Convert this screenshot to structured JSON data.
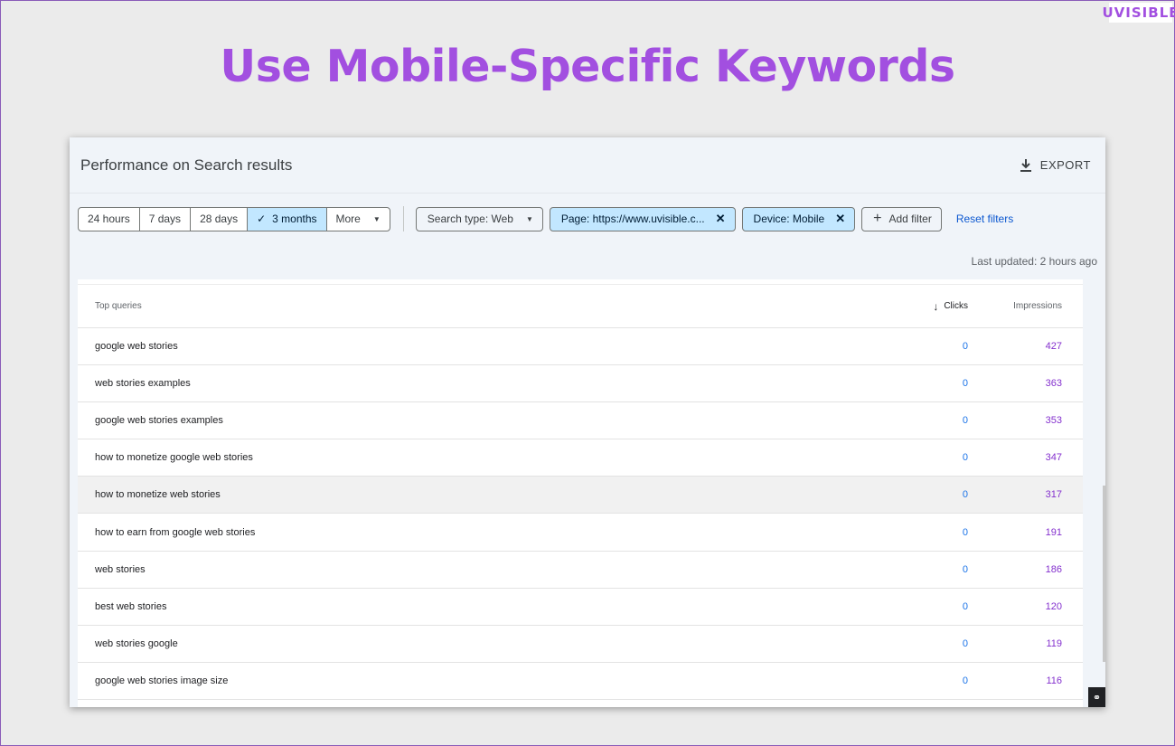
{
  "brand": {
    "logo_text": "UVISIBLE"
  },
  "headline": "Use Mobile-Specific Keywords",
  "panel": {
    "title": "Performance on Search results",
    "export_label": "EXPORT",
    "export_icon": "download-icon"
  },
  "date_range": {
    "options": [
      "24 hours",
      "7 days",
      "28 days",
      "3 months",
      "More"
    ],
    "selected": "3 months"
  },
  "filters": {
    "search_type": "Search type: Web",
    "page": "Page: https://www.uvisible.c...",
    "device": "Device: Mobile",
    "add_filter": "Add filter",
    "reset": "Reset filters"
  },
  "last_updated": "Last updated: 2 hours ago",
  "table": {
    "headers": {
      "query": "Top queries",
      "clicks": "Clicks",
      "impressions": "Impressions"
    },
    "sort_column": "Clicks",
    "rows": [
      {
        "query": "google web stories",
        "clicks": "0",
        "impressions": "427"
      },
      {
        "query": "web stories examples",
        "clicks": "0",
        "impressions": "363"
      },
      {
        "query": "google web stories examples",
        "clicks": "0",
        "impressions": "353"
      },
      {
        "query": "how to monetize google web stories",
        "clicks": "0",
        "impressions": "347"
      },
      {
        "query": "how to monetize web stories",
        "clicks": "0",
        "impressions": "317"
      },
      {
        "query": "how to earn from google web stories",
        "clicks": "0",
        "impressions": "191"
      },
      {
        "query": "web stories",
        "clicks": "0",
        "impressions": "186"
      },
      {
        "query": "best web stories",
        "clicks": "0",
        "impressions": "120"
      },
      {
        "query": "web stories google",
        "clicks": "0",
        "impressions": "119"
      },
      {
        "query": "google web stories image size",
        "clicks": "0",
        "impressions": "116"
      }
    ],
    "hover_row": 4
  },
  "colors": {
    "headline": "#a24fe0",
    "active_chip": "#c2e7ff",
    "clicks": "#1a73e8",
    "impressions": "#8430ce",
    "link": "#0b57d0"
  }
}
